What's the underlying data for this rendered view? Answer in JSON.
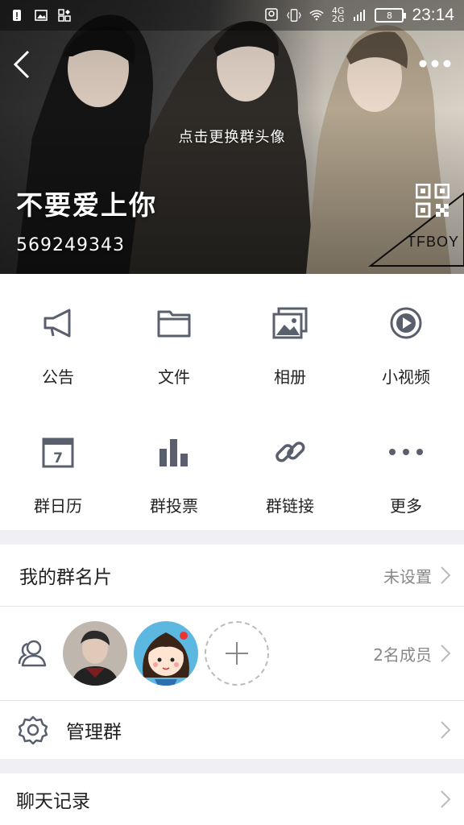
{
  "status_bar": {
    "network_label": "4G\n2G",
    "battery": "8",
    "time": "23:14"
  },
  "header": {
    "change_avatar_hint": "点击更换群头像",
    "group_name": "不要爱上你",
    "group_id": "569249343",
    "watermark": "TFBOY"
  },
  "features": [
    {
      "label": "公告",
      "icon": "megaphone-icon"
    },
    {
      "label": "文件",
      "icon": "folder-icon"
    },
    {
      "label": "相册",
      "icon": "photo-album-icon"
    },
    {
      "label": "小视频",
      "icon": "video-play-icon"
    },
    {
      "label": "群日历",
      "icon": "calendar-icon"
    },
    {
      "label": "群投票",
      "icon": "bar-chart-icon"
    },
    {
      "label": "群链接",
      "icon": "link-icon"
    },
    {
      "label": "更多",
      "icon": "more-dots-icon"
    }
  ],
  "my_card": {
    "title": "我的群名片",
    "value": "未设置"
  },
  "members": {
    "count_label": "2名成员"
  },
  "manage": {
    "title": "管理群"
  },
  "chat_history": {
    "title": "聊天记录"
  },
  "colors": {
    "icon_gray": "#5a5f6e",
    "separator": "#efeff4",
    "hint_text": "#888888"
  }
}
